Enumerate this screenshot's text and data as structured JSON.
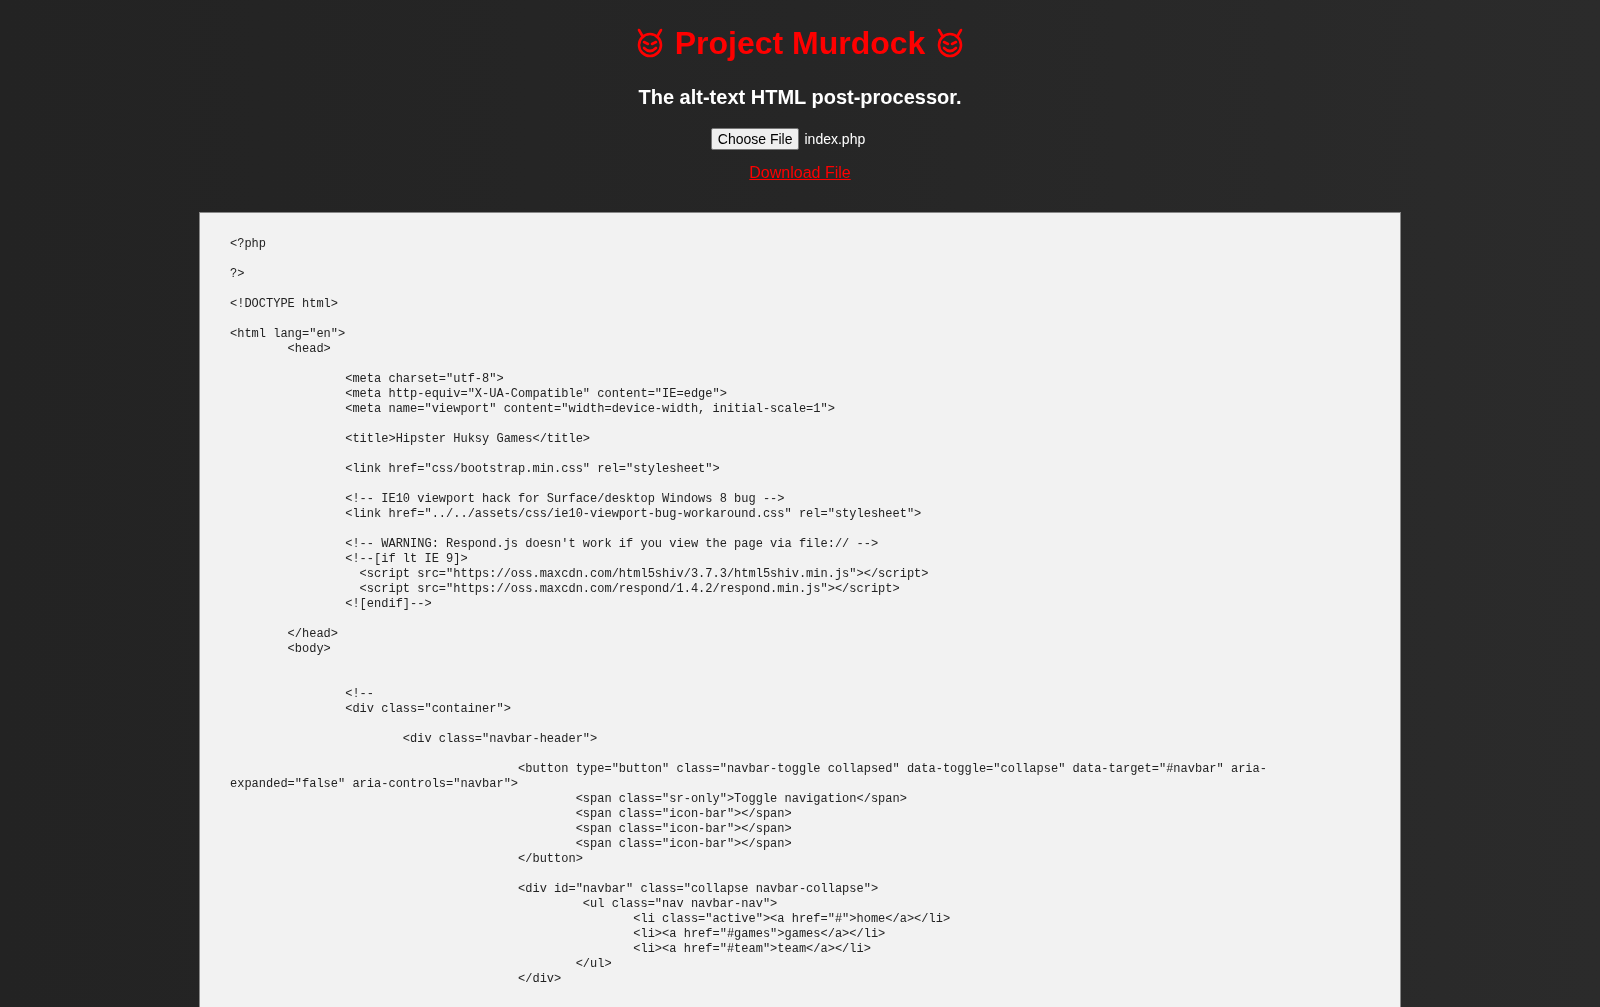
{
  "header": {
    "title": "Project Murdock",
    "subtitle": "The alt-text HTML post-processor."
  },
  "upload": {
    "button": "Choose File",
    "file_name": "index.php"
  },
  "download_link": "Download File",
  "code": "<?php\n\n?>\n\n<!DOCTYPE html>\n\n<html lang=\"en\">\n\t<head>\n\n\t\t<meta charset=\"utf-8\">\n\t\t<meta http-equiv=\"X-UA-Compatible\" content=\"IE=edge\">\n\t\t<meta name=\"viewport\" content=\"width=device-width, initial-scale=1\">\n\n\t\t<title>Hipster Huksy Games</title>\n\n\t\t<link href=\"css/bootstrap.min.css\" rel=\"stylesheet\">\n\n\t\t<!-- IE10 viewport hack for Surface/desktop Windows 8 bug -->\n\t\t<link href=\"../../assets/css/ie10-viewport-bug-workaround.css\" rel=\"stylesheet\">\n\n\t\t<!-- WARNING: Respond.js doesn't work if you view the page via file:// -->\n\t\t<!--[if lt IE 9]>\n\t\t  <script src=\"https://oss.maxcdn.com/html5shiv/3.7.3/html5shiv.min.js\"></script>\n\t\t  <script src=\"https://oss.maxcdn.com/respond/1.4.2/respond.min.js\"></script>\n\t\t<![endif]-->\n\n\t</head>\n\t<body>\n\n\n\t\t<!--\n\t\t<div class=\"container\">\n\n\t\t\t<div class=\"navbar-header\">\n\n\t\t\t\t\t<button type=\"button\" class=\"navbar-toggle collapsed\" data-toggle=\"collapse\" data-target=\"#navbar\" aria-expanded=\"false\" aria-controls=\"navbar\">\n\t\t\t\t\t\t<span class=\"sr-only\">Toggle navigation</span>\n\t\t\t\t\t\t<span class=\"icon-bar\"></span>\n\t\t\t\t\t\t<span class=\"icon-bar\"></span>\n\t\t\t\t\t\t<span class=\"icon-bar\"></span>\n\t\t\t\t\t</button>\n\n\t\t\t\t\t<div id=\"navbar\" class=\"collapse navbar-collapse\">\n\t\t\t\t\t         <ul class=\"nav navbar-nav\">\n\t\t\t\t\t\t\t<li class=\"active\"><a href=\"#\">home</a></li>\n\t\t\t\t\t\t\t<li><a href=\"#games\">games</a></li>\n\t\t\t\t\t\t\t<li><a href=\"#team\">team</a></li>\n\t\t\t\t\t\t</ul>\n\t\t\t\t\t</div>"
}
